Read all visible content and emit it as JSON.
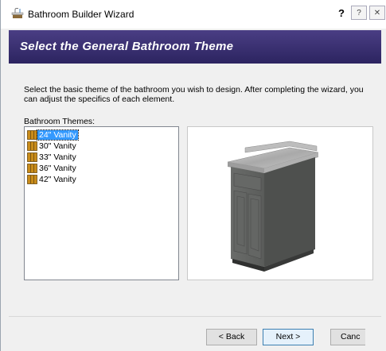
{
  "window": {
    "title": "Bathroom Builder Wizard",
    "help_mark": "?",
    "help_button": "?",
    "close_button": "✕"
  },
  "banner": {
    "title": "Select the General Bathroom Theme"
  },
  "intro": {
    "text": "Select the basic theme of the bathroom you wish to design. After completing the wizard, you can adjust the specifics of each element."
  },
  "themes": {
    "label": "Bathroom Themes:",
    "items": [
      {
        "label": "24\" Vanity",
        "selected": true
      },
      {
        "label": "30\" Vanity",
        "selected": false
      },
      {
        "label": "33\" Vanity",
        "selected": false
      },
      {
        "label": "36\" Vanity",
        "selected": false
      },
      {
        "label": "42\" Vanity",
        "selected": false
      }
    ]
  },
  "buttons": {
    "back": "< Back",
    "next": "Next >",
    "cancel": "Canc"
  },
  "colors": {
    "banner": "#3a3072",
    "selection": "#3399ff",
    "cabinet": "#5a5c5a",
    "countertop": "#b8b8b8"
  }
}
